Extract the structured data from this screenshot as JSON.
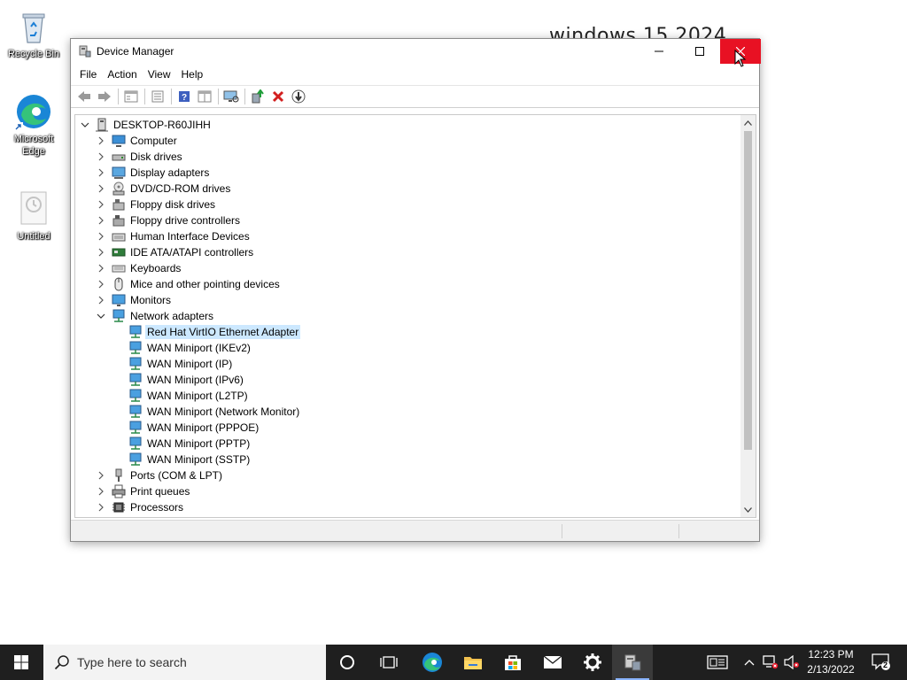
{
  "desktop": {
    "wallpaper_text": "windows 15 2024",
    "icons": [
      {
        "label": "Recycle Bin",
        "icon": "recycle-bin-icon"
      },
      {
        "label": "Microsoft Edge",
        "icon": "edge-icon"
      },
      {
        "label": "Untitled",
        "icon": "document-icon"
      }
    ]
  },
  "window": {
    "title": "Device Manager",
    "menu": [
      "File",
      "Action",
      "View",
      "Help"
    ],
    "toolbar_icons": [
      "back-icon",
      "forward-icon",
      "properties-pane-icon",
      "list-view-icon",
      "help-icon",
      "details-view-icon",
      "monitor-scan-icon",
      "update-driver-icon",
      "uninstall-icon",
      "download-icon"
    ],
    "computer_name": "DESKTOP-R60JIHH",
    "categories": [
      {
        "label": "Computer",
        "icon": "computer-icon",
        "expanded": false
      },
      {
        "label": "Disk drives",
        "icon": "disk-drive-icon",
        "expanded": false
      },
      {
        "label": "Display adapters",
        "icon": "display-adapter-icon",
        "expanded": false
      },
      {
        "label": "DVD/CD-ROM drives",
        "icon": "dvd-icon",
        "expanded": false
      },
      {
        "label": "Floppy disk drives",
        "icon": "floppy-icon",
        "expanded": false
      },
      {
        "label": "Floppy drive controllers",
        "icon": "floppy-controller-icon",
        "expanded": false
      },
      {
        "label": "Human Interface Devices",
        "icon": "hid-icon",
        "expanded": false
      },
      {
        "label": "IDE ATA/ATAPI controllers",
        "icon": "ide-controller-icon",
        "expanded": false
      },
      {
        "label": "Keyboards",
        "icon": "keyboard-icon",
        "expanded": false
      },
      {
        "label": "Mice and other pointing devices",
        "icon": "mouse-icon",
        "expanded": false
      },
      {
        "label": "Monitors",
        "icon": "monitor-icon",
        "expanded": false
      },
      {
        "label": "Network adapters",
        "icon": "network-adapter-icon",
        "expanded": true,
        "children": [
          "Red Hat VirtIO Ethernet Adapter",
          "WAN Miniport (IKEv2)",
          "WAN Miniport (IP)",
          "WAN Miniport (IPv6)",
          "WAN Miniport (L2TP)",
          "WAN Miniport (Network Monitor)",
          "WAN Miniport (PPPOE)",
          "WAN Miniport (PPTP)",
          "WAN Miniport (SSTP)"
        ],
        "selected_child": 0
      },
      {
        "label": "Ports (COM & LPT)",
        "icon": "port-icon",
        "expanded": false
      },
      {
        "label": "Print queues",
        "icon": "printer-icon",
        "expanded": false
      },
      {
        "label": "Processors",
        "icon": "processor-icon",
        "expanded": false
      }
    ]
  },
  "taskbar": {
    "search_placeholder": "Type here to search",
    "apps": [
      "task-view-icon",
      "edge-icon",
      "file-explorer-icon",
      "store-icon",
      "mail-icon",
      "settings-icon",
      "device-manager-icon"
    ],
    "time": "12:23 PM",
    "date": "2/13/2022",
    "notification_count": "2"
  },
  "colors": {
    "close_red": "#e81123",
    "selection": "#cce8ff",
    "taskbar": "#1f1f1f"
  }
}
